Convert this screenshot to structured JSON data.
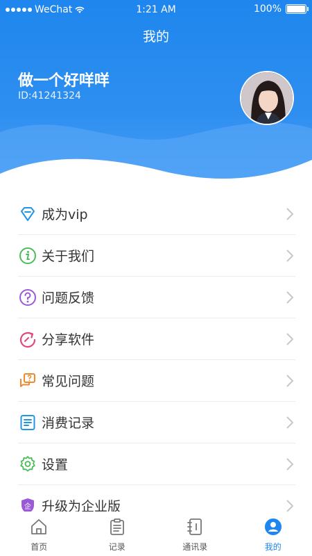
{
  "status_bar": {
    "carrier": "WeChat",
    "time": "1:21 AM",
    "battery": "100%"
  },
  "nav": {
    "title": "我的"
  },
  "user": {
    "name": "做一个好咩咩",
    "id": "ID:41241324"
  },
  "menu": [
    {
      "label": "成为vip",
      "icon": "diamond-icon",
      "color": "#2196e0"
    },
    {
      "label": "关于我们",
      "icon": "info-icon",
      "color": "#4cbb5a"
    },
    {
      "label": "问题反馈",
      "icon": "question-icon",
      "color": "#9a5ad8"
    },
    {
      "label": "分享软件",
      "icon": "share-icon",
      "color": "#e04a7a"
    },
    {
      "label": "常见问题",
      "icon": "faq-icon",
      "color": "#ef8a2c"
    },
    {
      "label": "消费记录",
      "icon": "document-icon",
      "color": "#2196e0"
    },
    {
      "label": "设置",
      "icon": "gear-icon",
      "color": "#4cbb5a"
    },
    {
      "label": "升级为企业版",
      "icon": "enterprise-shield-icon",
      "color": "#9a5ad8",
      "badge": "企"
    }
  ],
  "tabs": [
    {
      "label": "首页",
      "icon": "home-icon"
    },
    {
      "label": "记录",
      "icon": "clipboard-icon"
    },
    {
      "label": "通讯录",
      "icon": "contacts-book-icon"
    },
    {
      "label": "我的",
      "icon": "user-icon",
      "active": true
    }
  ],
  "colors": {
    "primary": "#1e86ee",
    "text": "#333333",
    "divider": "#ececec"
  }
}
